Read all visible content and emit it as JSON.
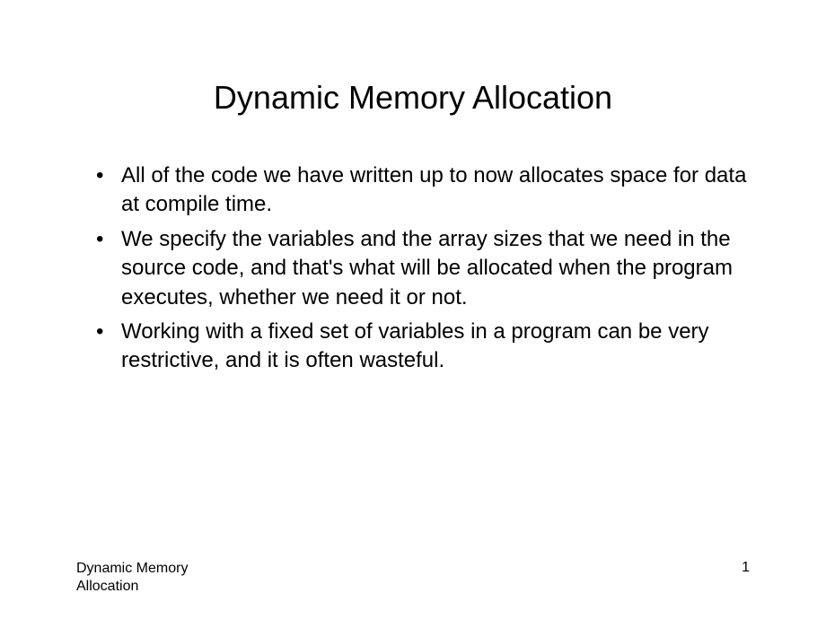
{
  "slide": {
    "title": "Dynamic Memory Allocation",
    "bullets": [
      "All of the code we have written up to now allocates space for data at compile time.",
      "We specify the variables and the array sizes that we need in the source code, and that's what will be allocated when the program executes, whether we need it or not.",
      "Working with a fixed set of variables in a program can be very restrictive, and it is often wasteful."
    ],
    "footer": {
      "left": "Dynamic Memory Allocation",
      "pageNumber": "1"
    }
  }
}
